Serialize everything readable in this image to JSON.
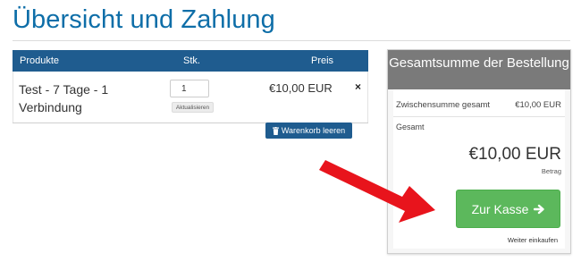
{
  "page": {
    "title": "Übersicht und Zahlung"
  },
  "cart": {
    "headers": {
      "product": "Produkte",
      "qty": "Stk.",
      "price": "Preis"
    },
    "items": [
      {
        "name": "Test - 7 Tage - 1 Verbindung",
        "qty": "1",
        "price": "€10,00 EUR",
        "remove": "×"
      }
    ],
    "update_label": "Aktualisieren",
    "empty_cart_label": "Warenkorb leeren"
  },
  "summary": {
    "title": "Gesamtsumme der Bestellung",
    "subtotal_label": "Zwischensumme gesamt",
    "subtotal_value": "€10,00 EUR",
    "total_label": "Gesamt",
    "total_value": "€10,00 EUR",
    "amount_label": "Betrag",
    "checkout_label": "Zur Kasse",
    "continue_label": "Weiter einkaufen"
  },
  "colors": {
    "title_blue": "#0e6ea8",
    "header_blue": "#1f5c8f",
    "panel_grey": "#7a7a7a",
    "checkout_green": "#5cb85c",
    "annotation_red": "#e8141c"
  },
  "icons": {
    "remove": "close-icon",
    "trash": "trash-icon",
    "checkout_arrow": "arrow-right-icon",
    "annotation": "red-arrow-icon"
  }
}
